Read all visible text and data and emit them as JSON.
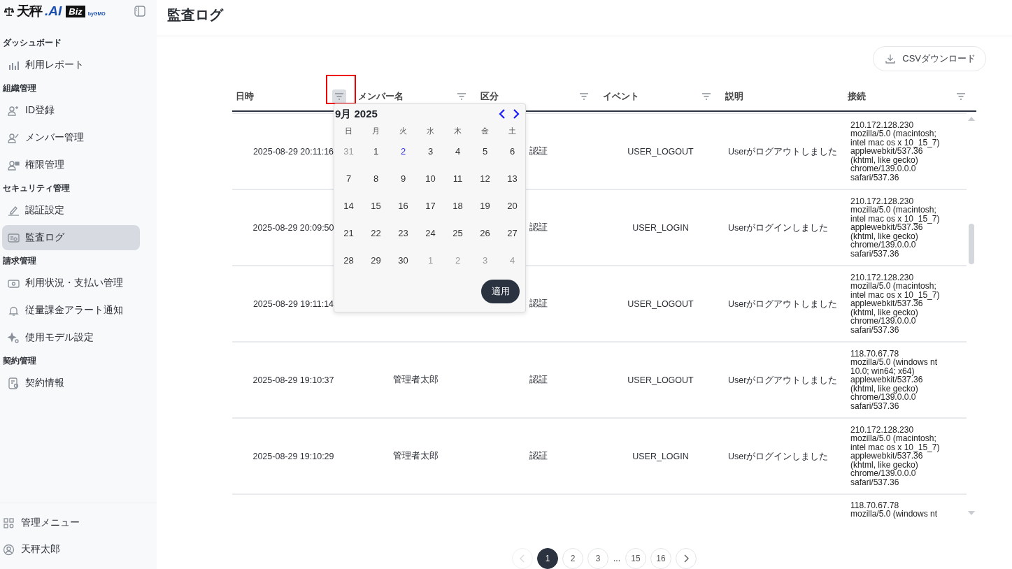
{
  "sidebar": {
    "logo": {
      "name": "天秤",
      "suffix": ".AI",
      "badge": "Biz",
      "by": "byGMO"
    },
    "sections": [
      {
        "heading": "ダッシュボード",
        "items": [
          {
            "label": "利用レポート",
            "selected": false
          }
        ]
      },
      {
        "heading": "組織管理",
        "items": [
          {
            "label": "ID登録",
            "selected": false
          },
          {
            "label": "メンバー管理",
            "selected": false
          },
          {
            "label": "権限管理",
            "selected": false
          }
        ]
      },
      {
        "heading": "セキュリティ管理",
        "items": [
          {
            "label": "認証設定",
            "selected": false
          },
          {
            "label": "監査ログ",
            "selected": true
          }
        ]
      },
      {
        "heading": "請求管理",
        "items": [
          {
            "label": "利用状況・支払い管理",
            "selected": false
          },
          {
            "label": "従量課金アラート通知",
            "selected": false
          },
          {
            "label": "使用モデル設定",
            "selected": false
          }
        ]
      },
      {
        "heading": "契約管理",
        "items": [
          {
            "label": "契約情報",
            "selected": false
          }
        ]
      }
    ],
    "footer": [
      {
        "label": "管理メニュー"
      },
      {
        "label": "天秤太郎"
      }
    ]
  },
  "page": {
    "title": "監査ログ",
    "csv_button": "CSVダウンロード"
  },
  "table": {
    "columns": [
      {
        "label": "日時",
        "filter": {
          "active": true,
          "highlighted": true
        }
      },
      {
        "label": "メンバー名",
        "filter": {
          "active": false,
          "highlighted": false
        }
      },
      {
        "label": "区分",
        "filter": {
          "active": false,
          "highlighted": false
        }
      },
      {
        "label": "イベント",
        "filter": {
          "active": false,
          "highlighted": false
        }
      },
      {
        "label": "説明"
      },
      {
        "label": "接続",
        "filter": {
          "active": false,
          "highlighted": false
        }
      }
    ],
    "rows": [
      {
        "datetime": "2025-08-29 20:11:16",
        "category": "認証",
        "event": "USER_LOGOUT",
        "description": "Userがログアウトしました",
        "connection": [
          "210.172.128.230",
          "mozilla/5.0 (macintosh;",
          "intel mac os x 10_15_7)",
          "applewebkit/537.36",
          "(khtml, like gecko)",
          "chrome/139.0.0.0",
          "safari/537.36"
        ]
      },
      {
        "datetime": "2025-08-29 20:09:50",
        "category": "認証",
        "event": "USER_LOGIN",
        "description": "Userがログインしました",
        "connection": [
          "210.172.128.230",
          "mozilla/5.0 (macintosh;",
          "intel mac os x 10_15_7)",
          "applewebkit/537.36",
          "(khtml, like gecko)",
          "chrome/139.0.0.0",
          "safari/537.36"
        ]
      },
      {
        "datetime": "2025-08-29 19:11:14",
        "category": "認証",
        "event": "USER_LOGOUT",
        "description": "Userがログアウトしました",
        "connection": [
          "210.172.128.230",
          "mozilla/5.0 (macintosh;",
          "intel mac os x 10_15_7)",
          "applewebkit/537.36",
          "(khtml, like gecko)",
          "chrome/139.0.0.0",
          "safari/537.36"
        ]
      },
      {
        "datetime": "2025-08-29 19:10:37",
        "member": "管理者太郎",
        "category": "認証",
        "event": "USER_LOGOUT",
        "description": "Userがログアウトしました",
        "connection": [
          "118.70.67.78",
          "mozilla/5.0 (windows nt",
          "10.0; win64; x64)",
          "applewebkit/537.36",
          "(khtml, like gecko)",
          "chrome/139.0.0.0",
          "safari/537.36"
        ]
      },
      {
        "datetime": "2025-08-29 19:10:29",
        "member": "管理者太郎",
        "category": "認証",
        "event": "USER_LOGIN",
        "description": "Userがログインしました",
        "connection": [
          "210.172.128.230",
          "mozilla/5.0 (macintosh;",
          "intel mac os x 10_15_7)",
          "applewebkit/537.36",
          "(khtml, like gecko)",
          "chrome/139.0.0.0",
          "safari/537.36"
        ]
      },
      {
        "connection": [
          "118.70.67.78",
          "mozilla/5.0 (windows nt"
        ]
      }
    ]
  },
  "date_picker": {
    "month_label": "9月 2025",
    "weekdays": [
      "日",
      "月",
      "火",
      "水",
      "木",
      "金",
      "土"
    ],
    "weeks": [
      [
        {
          "day": "31",
          "outside": true,
          "today": false
        },
        {
          "day": "1",
          "outside": false,
          "today": false
        },
        {
          "day": "2",
          "outside": false,
          "today": true
        },
        {
          "day": "3",
          "outside": false,
          "today": false
        },
        {
          "day": "4",
          "outside": false,
          "today": false
        },
        {
          "day": "5",
          "outside": false,
          "today": false
        },
        {
          "day": "6",
          "outside": false,
          "today": false
        }
      ],
      [
        {
          "day": "7",
          "outside": false,
          "today": false
        },
        {
          "day": "8",
          "outside": false,
          "today": false
        },
        {
          "day": "9",
          "outside": false,
          "today": false
        },
        {
          "day": "10",
          "outside": false,
          "today": false
        },
        {
          "day": "11",
          "outside": false,
          "today": false
        },
        {
          "day": "12",
          "outside": false,
          "today": false
        },
        {
          "day": "13",
          "outside": false,
          "today": false
        }
      ],
      [
        {
          "day": "14",
          "outside": false,
          "today": false
        },
        {
          "day": "15",
          "outside": false,
          "today": false
        },
        {
          "day": "16",
          "outside": false,
          "today": false
        },
        {
          "day": "17",
          "outside": false,
          "today": false
        },
        {
          "day": "18",
          "outside": false,
          "today": false
        },
        {
          "day": "19",
          "outside": false,
          "today": false
        },
        {
          "day": "20",
          "outside": false,
          "today": false
        }
      ],
      [
        {
          "day": "21",
          "outside": false,
          "today": false
        },
        {
          "day": "22",
          "outside": false,
          "today": false
        },
        {
          "day": "23",
          "outside": false,
          "today": false
        },
        {
          "day": "24",
          "outside": false,
          "today": false
        },
        {
          "day": "25",
          "outside": false,
          "today": false
        },
        {
          "day": "26",
          "outside": false,
          "today": false
        },
        {
          "day": "27",
          "outside": false,
          "today": false
        }
      ],
      [
        {
          "day": "28",
          "outside": false,
          "today": false
        },
        {
          "day": "29",
          "outside": false,
          "today": false
        },
        {
          "day": "30",
          "outside": false,
          "today": false
        },
        {
          "day": "1",
          "outside": true,
          "today": false
        },
        {
          "day": "2",
          "outside": true,
          "today": false
        },
        {
          "day": "3",
          "outside": true,
          "today": false
        },
        {
          "day": "4",
          "outside": true,
          "today": false
        }
      ]
    ],
    "apply_button": "適用"
  },
  "pagination": {
    "prev_disabled": true,
    "next_disabled": false,
    "pages": [
      {
        "kind": "page",
        "label": "1",
        "selected": true
      },
      {
        "kind": "page",
        "label": "2",
        "selected": false
      },
      {
        "kind": "page",
        "label": "3",
        "selected": false
      },
      {
        "kind": "ellipsis",
        "label": "...",
        "selected": false
      },
      {
        "kind": "page",
        "label": "15",
        "selected": false
      },
      {
        "kind": "page",
        "label": "16",
        "selected": false
      }
    ]
  }
}
